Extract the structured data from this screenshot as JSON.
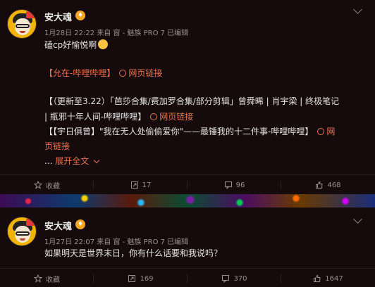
{
  "posts": [
    {
      "username": "安大魂",
      "meta": "1月28日 22:22 来自 窗 - 魅族 PRO 7  已编辑",
      "lines": {
        "l1_text": "磕cp好愉悦啊",
        "l2_text": "【允在-哔哩哔哩】",
        "l2_link": "网页链接",
        "l3a_text": "【（更新至3.22）「芭莎合集/费加罗合集/部分剪辑」曾舜晞 | 肖宇梁 | 终极笔记",
        "l3b_text": "| 瓶邪十年人间-哔哩哔哩】",
        "l3b_link": "网页链接",
        "l4a_text": "【【宇日俱曾】\"我在无人处偷偷爱你\"——最锤我的十二件事-哔哩哔哩】",
        "l4a_link": "网",
        "l4b_link": "页链接",
        "more_prefix": "...",
        "more_label": "展开全文"
      },
      "actions": {
        "favorite": "收藏",
        "repost": "17",
        "comment": "96",
        "like": "468"
      }
    },
    {
      "username": "安大魂",
      "meta": "1月27日 22:07 来自 窗 - 魅族 PRO 7  已编辑",
      "text": "如果明天是世界末日，你有什么话要和我说吗？",
      "actions": {
        "favorite": "收藏",
        "repost": "169",
        "comment": "370",
        "like": "1647"
      }
    }
  ],
  "colors": {
    "link": "#eb7350",
    "background": "#150a0c",
    "meta_text": "#9a8f8f"
  },
  "icons": {
    "favorite": "star-icon",
    "repost": "repost-icon",
    "comment": "comment-icon",
    "like": "thumbs-up-icon",
    "link": "link-icon",
    "menu": "chevron-down-icon"
  }
}
